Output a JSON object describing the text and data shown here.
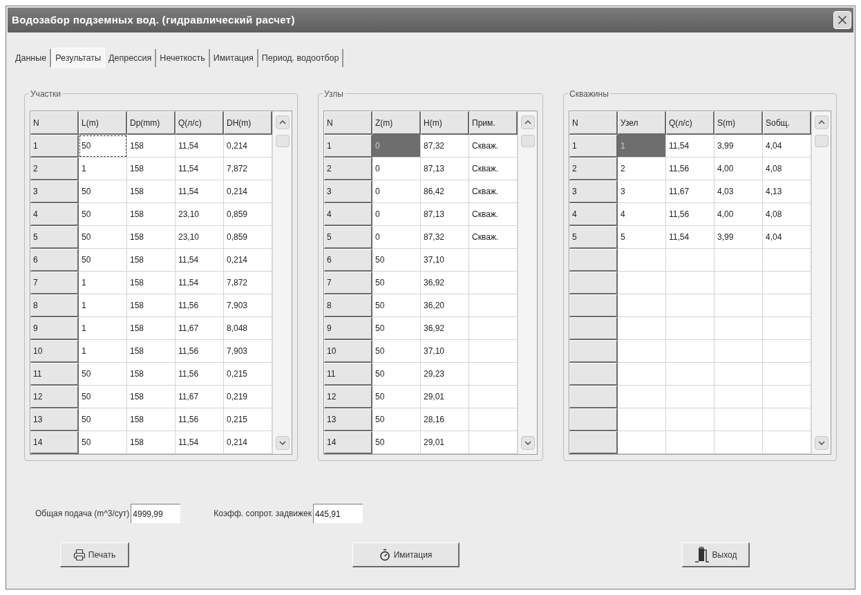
{
  "window": {
    "title": "Водозабор подземных вод. (гидравлический расчет)"
  },
  "tabs": [
    {
      "label": "Данные",
      "selected": false
    },
    {
      "label": "Результаты",
      "selected": true
    },
    {
      "label": "Депрессия",
      "selected": false
    },
    {
      "label": "Нечеткость",
      "selected": false
    },
    {
      "label": "Имитация",
      "selected": false
    },
    {
      "label": "Период. водоотбор",
      "selected": false
    }
  ],
  "panels": [
    {
      "title": "Участки",
      "kind": "focus",
      "row_header_title": "N",
      "columns": [
        "L(m)",
        "Dp(mm)",
        "Q(л/с)",
        "DH(m)"
      ],
      "rows": [
        {
          "n": "1",
          "cells": [
            {
              "text": "50",
              "selected": true
            },
            {
              "text": "158",
              "selected": false
            },
            {
              "text": "11,54",
              "selected": false
            },
            {
              "text": "0,214",
              "selected": false
            }
          ]
        },
        {
          "n": "2",
          "cells": [
            {
              "text": "1",
              "selected": false
            },
            {
              "text": "158",
              "selected": false
            },
            {
              "text": "11,54",
              "selected": false
            },
            {
              "text": "7,872",
              "selected": false
            }
          ]
        },
        {
          "n": "3",
          "cells": [
            {
              "text": "50",
              "selected": false
            },
            {
              "text": "158",
              "selected": false
            },
            {
              "text": "11,54",
              "selected": false
            },
            {
              "text": "0,214",
              "selected": false
            }
          ]
        },
        {
          "n": "4",
          "cells": [
            {
              "text": "50",
              "selected": false
            },
            {
              "text": "158",
              "selected": false
            },
            {
              "text": "23,10",
              "selected": false
            },
            {
              "text": "0,859",
              "selected": false
            }
          ]
        },
        {
          "n": "5",
          "cells": [
            {
              "text": "50",
              "selected": false
            },
            {
              "text": "158",
              "selected": false
            },
            {
              "text": "23,10",
              "selected": false
            },
            {
              "text": "0,859",
              "selected": false
            }
          ]
        },
        {
          "n": "6",
          "cells": [
            {
              "text": "50",
              "selected": false
            },
            {
              "text": "158",
              "selected": false
            },
            {
              "text": "11,54",
              "selected": false
            },
            {
              "text": "0,214",
              "selected": false
            }
          ]
        },
        {
          "n": "7",
          "cells": [
            {
              "text": "1",
              "selected": false
            },
            {
              "text": "158",
              "selected": false
            },
            {
              "text": "11,54",
              "selected": false
            },
            {
              "text": "7,872",
              "selected": false
            }
          ]
        },
        {
          "n": "8",
          "cells": [
            {
              "text": "1",
              "selected": false
            },
            {
              "text": "158",
              "selected": false
            },
            {
              "text": "11,56",
              "selected": false
            },
            {
              "text": "7,903",
              "selected": false
            }
          ]
        },
        {
          "n": "9",
          "cells": [
            {
              "text": "1",
              "selected": false
            },
            {
              "text": "158",
              "selected": false
            },
            {
              "text": "11,67",
              "selected": false
            },
            {
              "text": "8,048",
              "selected": false
            }
          ]
        },
        {
          "n": "10",
          "cells": [
            {
              "text": "1",
              "selected": false
            },
            {
              "text": "158",
              "selected": false
            },
            {
              "text": "11,56",
              "selected": false
            },
            {
              "text": "7,903",
              "selected": false
            }
          ]
        },
        {
          "n": "11",
          "cells": [
            {
              "text": "50",
              "selected": false
            },
            {
              "text": "158",
              "selected": false
            },
            {
              "text": "11,56",
              "selected": false
            },
            {
              "text": "0,215",
              "selected": false
            }
          ]
        },
        {
          "n": "12",
          "cells": [
            {
              "text": "50",
              "selected": false
            },
            {
              "text": "158",
              "selected": false
            },
            {
              "text": "11,67",
              "selected": false
            },
            {
              "text": "0,219",
              "selected": false
            }
          ]
        },
        {
          "n": "13",
          "cells": [
            {
              "text": "50",
              "selected": false
            },
            {
              "text": "158",
              "selected": false
            },
            {
              "text": "11,56",
              "selected": false
            },
            {
              "text": "0,215",
              "selected": false
            }
          ]
        },
        {
          "n": "14",
          "cells": [
            {
              "text": "50",
              "selected": false
            },
            {
              "text": "158",
              "selected": false
            },
            {
              "text": "11,54",
              "selected": false
            },
            {
              "text": "0,214",
              "selected": false
            }
          ]
        }
      ]
    },
    {
      "title": "Узлы",
      "kind": "highlight",
      "row_header_title": "N",
      "columns": [
        "Z(m)",
        "H(m)",
        "Прим."
      ],
      "rows": [
        {
          "n": "1",
          "cells": [
            {
              "text": "0",
              "selected": true
            },
            {
              "text": "87,32",
              "selected": false
            },
            {
              "text": "Скваж.",
              "selected": false
            }
          ]
        },
        {
          "n": "2",
          "cells": [
            {
              "text": "0",
              "selected": false
            },
            {
              "text": "87,13",
              "selected": false
            },
            {
              "text": "Скваж.",
              "selected": false
            }
          ]
        },
        {
          "n": "3",
          "cells": [
            {
              "text": "0",
              "selected": false
            },
            {
              "text": "86,42",
              "selected": false
            },
            {
              "text": "Скваж.",
              "selected": false
            }
          ]
        },
        {
          "n": "4",
          "cells": [
            {
              "text": "0",
              "selected": false
            },
            {
              "text": "87,13",
              "selected": false
            },
            {
              "text": "Скваж.",
              "selected": false
            }
          ]
        },
        {
          "n": "5",
          "cells": [
            {
              "text": "0",
              "selected": false
            },
            {
              "text": "87,32",
              "selected": false
            },
            {
              "text": "Скваж.",
              "selected": false
            }
          ]
        },
        {
          "n": "6",
          "cells": [
            {
              "text": "50",
              "selected": false
            },
            {
              "text": "37,10",
              "selected": false
            }
          ]
        },
        {
          "n": "7",
          "cells": [
            {
              "text": "50",
              "selected": false
            },
            {
              "text": "36,92",
              "selected": false
            }
          ]
        },
        {
          "n": "8",
          "cells": [
            {
              "text": "50",
              "selected": false
            },
            {
              "text": "36,20",
              "selected": false
            }
          ]
        },
        {
          "n": "9",
          "cells": [
            {
              "text": "50",
              "selected": false
            },
            {
              "text": "36,92",
              "selected": false
            }
          ]
        },
        {
          "n": "10",
          "cells": [
            {
              "text": "50",
              "selected": false
            },
            {
              "text": "37,10",
              "selected": false
            }
          ]
        },
        {
          "n": "11",
          "cells": [
            {
              "text": "50",
              "selected": false
            },
            {
              "text": "29,23",
              "selected": false
            }
          ]
        },
        {
          "n": "12",
          "cells": [
            {
              "text": "50",
              "selected": false
            },
            {
              "text": "29,01",
              "selected": false
            }
          ]
        },
        {
          "n": "13",
          "cells": [
            {
              "text": "50",
              "selected": false
            },
            {
              "text": "28,16",
              "selected": false
            }
          ]
        },
        {
          "n": "14",
          "cells": [
            {
              "text": "50",
              "selected": false
            },
            {
              "text": "29,01",
              "selected": false
            }
          ]
        }
      ]
    },
    {
      "title": "Скважины",
      "kind": "highlight",
      "row_header_title": "N",
      "columns": [
        "Узел",
        "Q(л/с)",
        "S(m)",
        "Sобщ."
      ],
      "rows": [
        {
          "n": "1",
          "cells": [
            {
              "text": "1",
              "selected": true
            },
            {
              "text": "11,54",
              "selected": false
            },
            {
              "text": "3,99",
              "selected": false
            },
            {
              "text": "4,04",
              "selected": false
            }
          ]
        },
        {
          "n": "2",
          "cells": [
            {
              "text": "2",
              "selected": false
            },
            {
              "text": "11,56",
              "selected": false
            },
            {
              "text": "4,00",
              "selected": false
            },
            {
              "text": "4,08",
              "selected": false
            }
          ]
        },
        {
          "n": "3",
          "cells": [
            {
              "text": "3",
              "selected": false
            },
            {
              "text": "11,67",
              "selected": false
            },
            {
              "text": "4,03",
              "selected": false
            },
            {
              "text": "4,13",
              "selected": false
            }
          ]
        },
        {
          "n": "4",
          "cells": [
            {
              "text": "4",
              "selected": false
            },
            {
              "text": "11,56",
              "selected": false
            },
            {
              "text": "4,00",
              "selected": false
            },
            {
              "text": "4,08",
              "selected": false
            }
          ]
        },
        {
          "n": "5",
          "cells": [
            {
              "text": "5",
              "selected": false
            },
            {
              "text": "11,54",
              "selected": false
            },
            {
              "text": "3,99",
              "selected": false
            },
            {
              "text": "4,04",
              "selected": false
            }
          ]
        }
      ]
    }
  ],
  "fields": [
    {
      "label": "Общая подача (m^3/сут)",
      "value": "4999,99"
    },
    {
      "label": "Коэфф. сопрот. задвижек",
      "value": "445,91"
    }
  ],
  "buttons": [
    {
      "label": "Печать",
      "kind": "print"
    },
    {
      "label": "Имитация",
      "kind": "simulate"
    },
    {
      "label": "Выход",
      "kind": "exit"
    }
  ]
}
